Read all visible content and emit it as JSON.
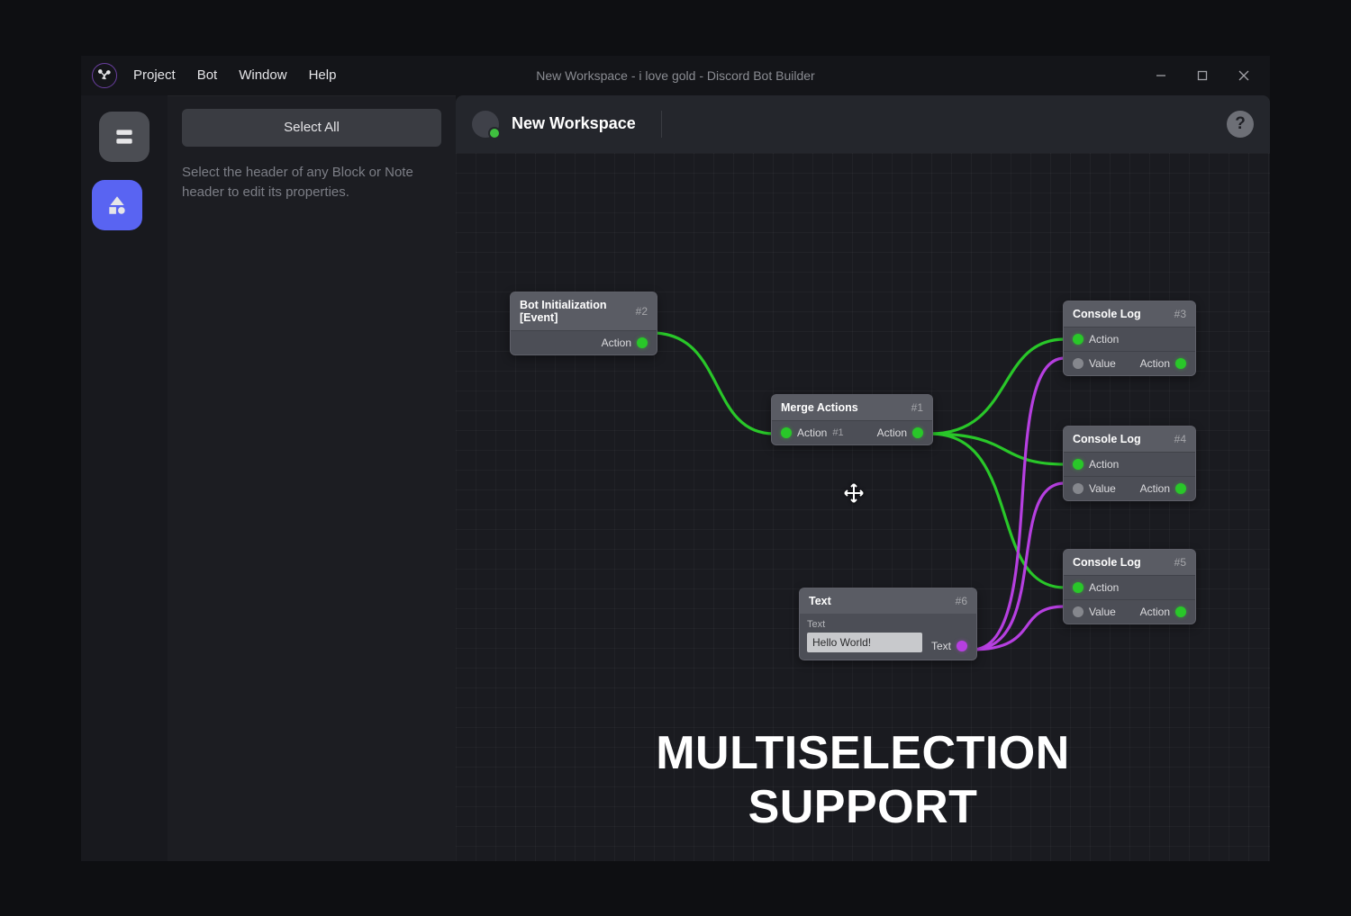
{
  "window": {
    "title": "New Workspace - i love gold - Discord Bot Builder",
    "menus": [
      "Project",
      "Bot",
      "Window",
      "Help"
    ]
  },
  "sidebar": {
    "select_all_label": "Select All",
    "hint": "Select the header of any Block or Note header to edit its properties."
  },
  "workspace": {
    "title": "New Workspace"
  },
  "caption": "MULTISELECTION SUPPORT",
  "nodes": {
    "n2": {
      "title": "Bot Initialization [Event]",
      "id": "#2",
      "out": "Action"
    },
    "n1": {
      "title": "Merge Actions",
      "id": "#1",
      "in_label": "Action",
      "in_sub": "#1",
      "out": "Action"
    },
    "n3": {
      "title": "Console Log",
      "id": "#3",
      "in_action": "Action",
      "in_value": "Value",
      "out": "Action"
    },
    "n4": {
      "title": "Console Log",
      "id": "#4",
      "in_action": "Action",
      "in_value": "Value",
      "out": "Action"
    },
    "n5": {
      "title": "Console Log",
      "id": "#5",
      "in_action": "Action",
      "in_value": "Value",
      "out": "Action"
    },
    "n6": {
      "title": "Text",
      "id": "#6",
      "field_label": "Text",
      "field_value": "Hello World!",
      "out": "Text"
    }
  }
}
